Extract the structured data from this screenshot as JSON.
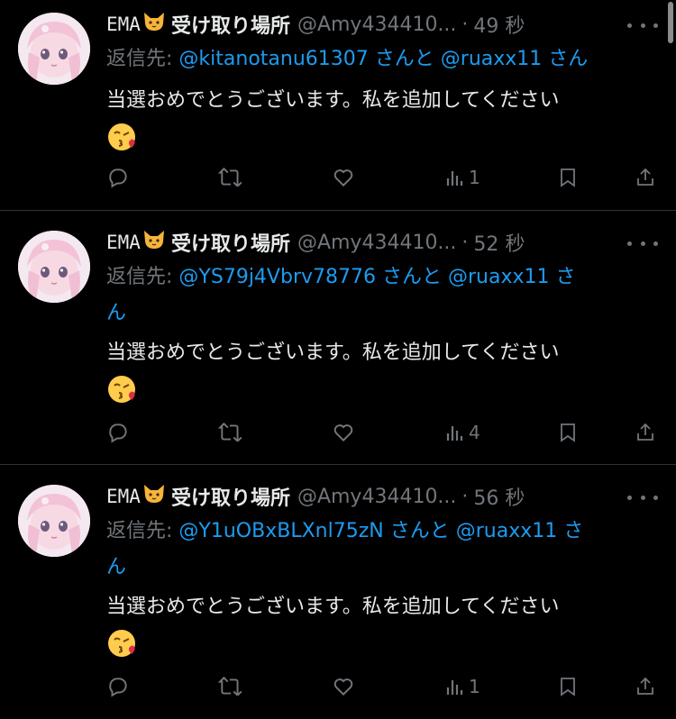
{
  "colors": {
    "background": "#000000",
    "text": "#e7e9ea",
    "muted": "#71767b",
    "mention": "#1d9bf0",
    "divider": "#2f3336"
  },
  "posts": [
    {
      "name_prefix": "EMA",
      "name_suffix": "受け取り場所",
      "handle": "@Amy434410...",
      "separator": "·",
      "time": "49 秒",
      "reply_prefix": "返信先:",
      "mention1": "@kitanotanu61307",
      "conj": "さんと",
      "mention2": "@ruaxx11",
      "suffix": "さん",
      "text": "当選おめでとうございます。私を追加してください",
      "emoji_icon": "face-blowing-kiss-icon",
      "views": "1"
    },
    {
      "name_prefix": "EMA",
      "name_suffix": "受け取り場所",
      "handle": "@Amy434410...",
      "separator": "·",
      "time": "52 秒",
      "reply_prefix": "返信先:",
      "mention1": "@YS79j4Vbrv78776",
      "conj": "さんと",
      "mention2": "@ruaxx11",
      "suffix": "さ",
      "suffix2": "ん",
      "text": "当選おめでとうございます。私を追加してください",
      "emoji_icon": "face-blowing-kiss-icon",
      "views": "4"
    },
    {
      "name_prefix": "EMA",
      "name_suffix": "受け取り場所",
      "handle": "@Amy434410...",
      "separator": "·",
      "time": "56 秒",
      "reply_prefix": "返信先:",
      "mention1": "@Y1uOBxBLXnl75zN",
      "conj": "さんと",
      "mention2": "@ruaxx11",
      "suffix": "さ",
      "suffix2": "ん",
      "text": "当選おめでとうございます。私を追加してください",
      "emoji_icon": "face-blowing-kiss-icon",
      "views": "1"
    }
  ],
  "icons": [
    "cat-face-icon",
    "more-icon",
    "reply-icon",
    "repost-icon",
    "like-icon",
    "views-icon",
    "bookmark-icon",
    "share-icon"
  ]
}
